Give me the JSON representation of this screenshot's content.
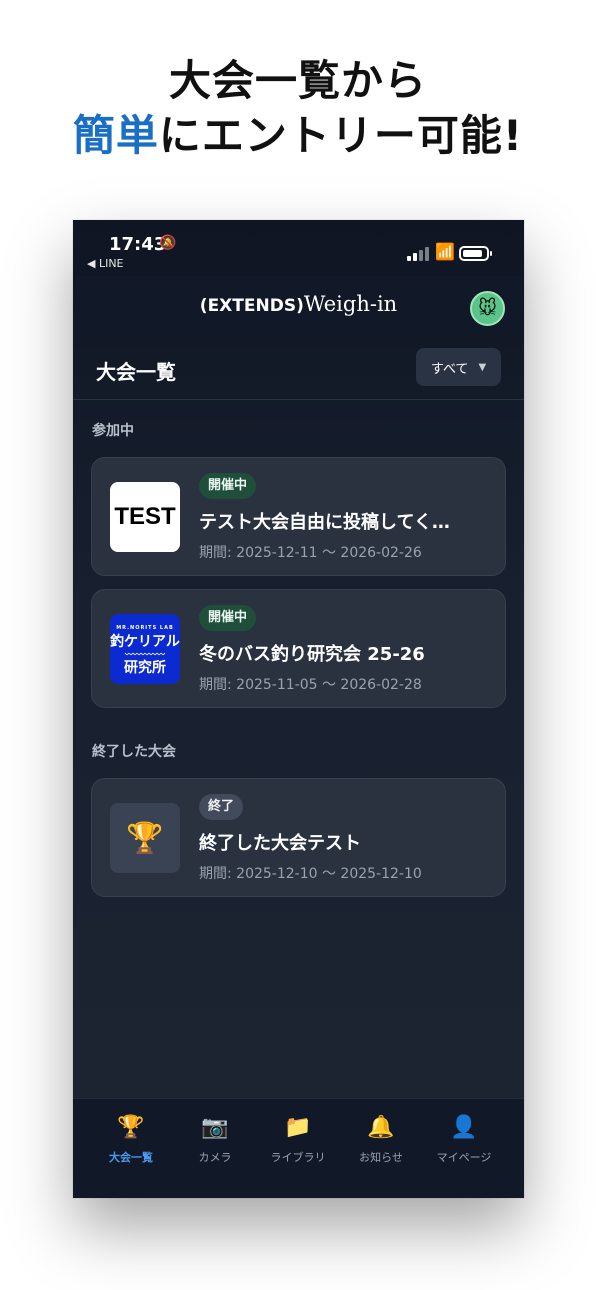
{
  "headline": {
    "line1": "大会一覧から",
    "accent": "簡単",
    "line2_rest": "にエントリー可能!"
  },
  "status_bar": {
    "time": "17:43",
    "mute_icon": "bell-slash-icon",
    "back_label": "◀ LINE"
  },
  "app_bar": {
    "brand_prefix": "(EXTENDS)",
    "brand_main": "Weigh-in",
    "avatar_icon": "🐭"
  },
  "list_header": {
    "title": "大会一覧",
    "filter_value": "すべて",
    "filter_caret": "▼"
  },
  "sections": {
    "active_label": "参加中",
    "ended_label": "終了した大会"
  },
  "tournaments": [
    {
      "thumb_text": "TEST",
      "badge": "開催中",
      "name": "テスト大会自由に投稿してく…",
      "period": "期間: 2025-12-11 〜 2026-02-26"
    },
    {
      "thumb_small": "MR.NORITS LAB",
      "thumb_line1": "釣ケリアル",
      "thumb_wave": "〰〰〰〰〰",
      "thumb_line2": "研究所",
      "badge": "開催中",
      "name": "冬のバス釣り研究会 25-26",
      "period": "期間: 2025-11-05 〜 2026-02-28"
    },
    {
      "thumb_icon": "🏆",
      "badge": "終了",
      "name": "終了した大会テスト",
      "period": "期間: 2025-12-10 〜 2025-12-10"
    }
  ],
  "tabs": [
    {
      "icon": "🏆",
      "label": "大会一覧"
    },
    {
      "icon": "📷",
      "label": "カメラ"
    },
    {
      "icon": "📁",
      "label": "ライブラリ"
    },
    {
      "icon": "🔔",
      "label": "お知らせ"
    },
    {
      "icon": "👤",
      "label": "マイページ"
    }
  ],
  "colors": {
    "accent": "#1a6fc4",
    "active_tab": "#4a9bef",
    "badge_open": "#1f4f3a"
  }
}
